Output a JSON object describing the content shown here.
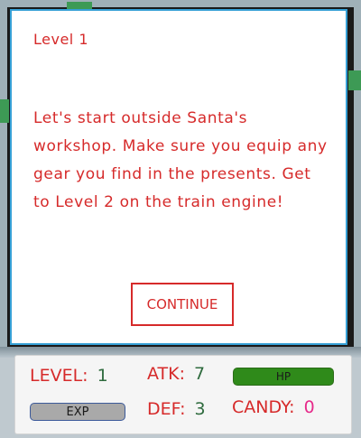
{
  "dialog": {
    "level_title": "Level 1",
    "message": "Let's start outside Santa's workshop. Make sure you equip any gear you find in the presents. Get to Level 2 on the train engine!",
    "continue_label": "CONTINUE"
  },
  "hud": {
    "level_label": "LEVEL:",
    "level_value": "1",
    "atk_label": "ATK:",
    "atk_value": "7",
    "hp_label": "HP",
    "hp_fraction": 1.0,
    "exp_label": "EXP",
    "exp_fraction": 0.0,
    "def_label": "DEF:",
    "def_value": "3",
    "candy_label": "CANDY:",
    "candy_value": "0"
  },
  "colors": {
    "text_red": "#d62a2a",
    "stat_value_green": "#2f6b3e",
    "candy_pink": "#e62a8a",
    "hp_green": "#2f8a1a",
    "exp_gray": "#a9a9a9",
    "dialog_border_blue": "#36a0d6"
  }
}
